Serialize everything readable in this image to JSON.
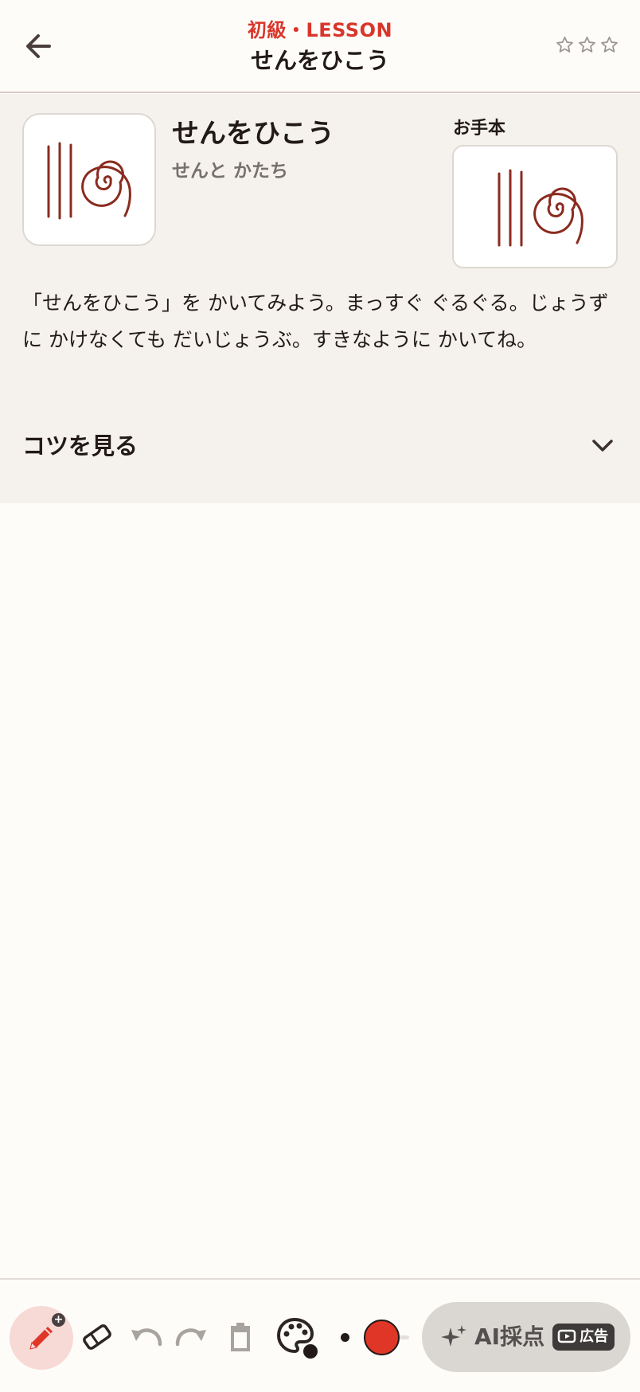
{
  "header": {
    "back_icon": "arrow-left-icon",
    "kicker": "初級・LESSON",
    "title": "せんをひこう",
    "stars": {
      "earned": 0,
      "total": 3,
      "icon": "star-outline-icon"
    }
  },
  "lesson": {
    "name": "せんをひこう",
    "category": "せんと かたち",
    "model_label": "お手本",
    "instructions": "「せんをひこう」を かいてみよう。まっすぐ ぐるぐる。じょうずに かけなくても だいじょうぶ。すきなように かいてね。",
    "tips_label": "コツを見る",
    "tips_icon": "chevron-down-icon"
  },
  "toolbar": {
    "tools": [
      {
        "name": "pen",
        "icon": "pen-icon",
        "active": true
      },
      {
        "name": "eraser",
        "icon": "eraser-icon"
      },
      {
        "name": "undo",
        "icon": "undo-icon"
      },
      {
        "name": "redo",
        "icon": "redo-icon"
      },
      {
        "name": "clear",
        "icon": "trash-icon"
      },
      {
        "name": "palette",
        "icon": "palette-icon"
      }
    ],
    "selected_color": "#e03628",
    "ai_button_label": "AI採点",
    "ad_badge_label": "広告"
  },
  "colors": {
    "accent": "#d9352b",
    "pen_active_bg": "#f7d9d6",
    "text": "#221a18",
    "panel_bg": "#f5f2ed",
    "stroke": "#8b2b1f"
  }
}
